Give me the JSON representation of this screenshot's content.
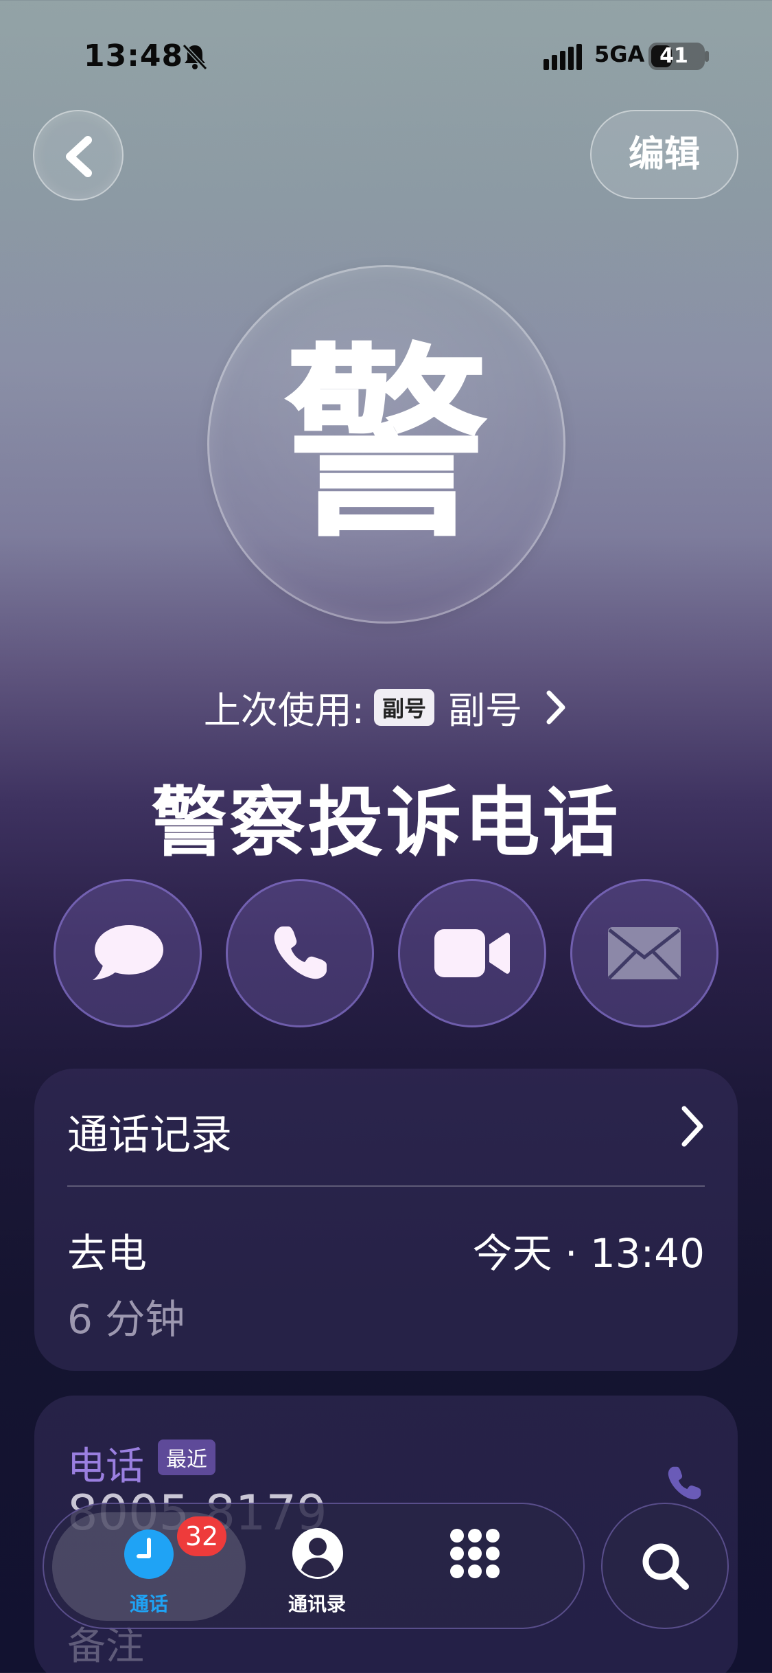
{
  "status_bar": {
    "time": "13:48",
    "network": "5GA",
    "battery": "41",
    "battery_level": 0.41
  },
  "nav": {
    "edit_label": "编辑"
  },
  "contact": {
    "avatar_char": "警",
    "last_used_label": "上次使用:",
    "sim_badge": "副号",
    "sim_name": "副号",
    "name": "警察投诉电话"
  },
  "call_log": {
    "title": "通话记录",
    "entries": [
      {
        "type": "去电",
        "time": "今天 · 13:40",
        "duration": "6 分钟"
      }
    ]
  },
  "phone": {
    "label": "电话",
    "badge": "最近",
    "number": "8005 8179"
  },
  "note": {
    "label": "备注"
  },
  "tabbar": {
    "calls_label": "通话",
    "calls_badge": "32",
    "contacts_label": "通讯录"
  },
  "colors": {
    "accent": "#1fa3f5",
    "badge": "#ee3b3b",
    "phone_label": "#9a7fe0"
  },
  "icons": {
    "back": "chevron-left-icon",
    "message": "message-bubble-icon",
    "call": "phone-icon",
    "video": "video-camera-icon",
    "mail": "envelope-icon",
    "search": "search-icon",
    "keypad": "keypad-icon",
    "contacts": "person-icon",
    "clock": "clock-icon"
  }
}
